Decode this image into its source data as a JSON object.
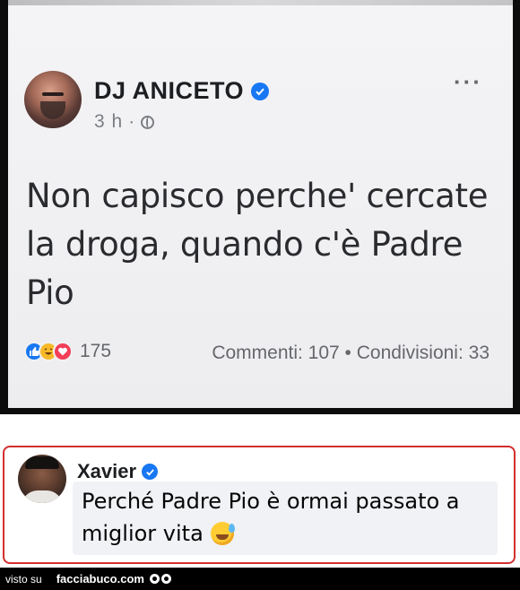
{
  "post": {
    "author": "DJ ANICETO",
    "time": "3 h",
    "text": "Non capisco perche' cercate la droga, quando c'è Padre Pio",
    "reactions_count": "175",
    "stats": "Commenti: 107 • Condivisioni: 33",
    "more_glyph": "···",
    "reaction_icons": [
      "like-icon",
      "haha-icon",
      "love-icon"
    ]
  },
  "comment": {
    "author": "Xavier",
    "text": "Perché Padre Pio è ormai passato a miglior vita",
    "emoji": "sweat-smile-emoji"
  },
  "footer": {
    "visto_su": "visto su",
    "site": "facciabuco.com"
  },
  "colors": {
    "verified_blue": "#1877f2",
    "comment_border": "#d32f2f",
    "footer_bg": "#000000"
  }
}
